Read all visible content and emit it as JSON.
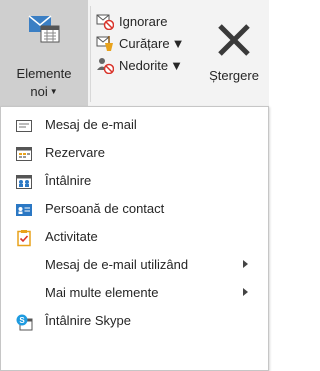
{
  "ribbon": {
    "new_items": {
      "label_line1": "Elemente",
      "label_line2": "noi",
      "icon": "new-items-icon"
    },
    "ignore": {
      "label": "Ignorare",
      "icon": "ignore-icon"
    },
    "cleanup": {
      "label": "Curățare",
      "icon": "cleanup-icon"
    },
    "junk": {
      "label": "Nedorite",
      "icon": "junk-icon"
    },
    "delete": {
      "label": "Ștergere",
      "icon": "delete-icon"
    }
  },
  "menu": {
    "items": [
      {
        "label": "Mesaj de e-mail",
        "icon": "email-message-icon",
        "submenu": false
      },
      {
        "label": "Rezervare",
        "icon": "appointment-icon",
        "submenu": false
      },
      {
        "label": "Întâlnire",
        "icon": "meeting-icon",
        "submenu": false
      },
      {
        "label": "Persoană de contact",
        "icon": "contact-icon",
        "submenu": false
      },
      {
        "label": "Activitate",
        "icon": "task-icon",
        "submenu": false
      },
      {
        "label": "Mesaj de e-mail utilizând",
        "icon": "",
        "submenu": true
      },
      {
        "label": "Mai multe elemente",
        "icon": "",
        "submenu": true
      },
      {
        "label": "Întâlnire Skype",
        "icon": "skype-meeting-icon",
        "submenu": false
      }
    ]
  },
  "colors": {
    "ribbon_bg": "#f3f3f3",
    "selected_button": "#cfcfcf",
    "accent_blue": "#2b78c4",
    "orange": "#e8a21b"
  }
}
